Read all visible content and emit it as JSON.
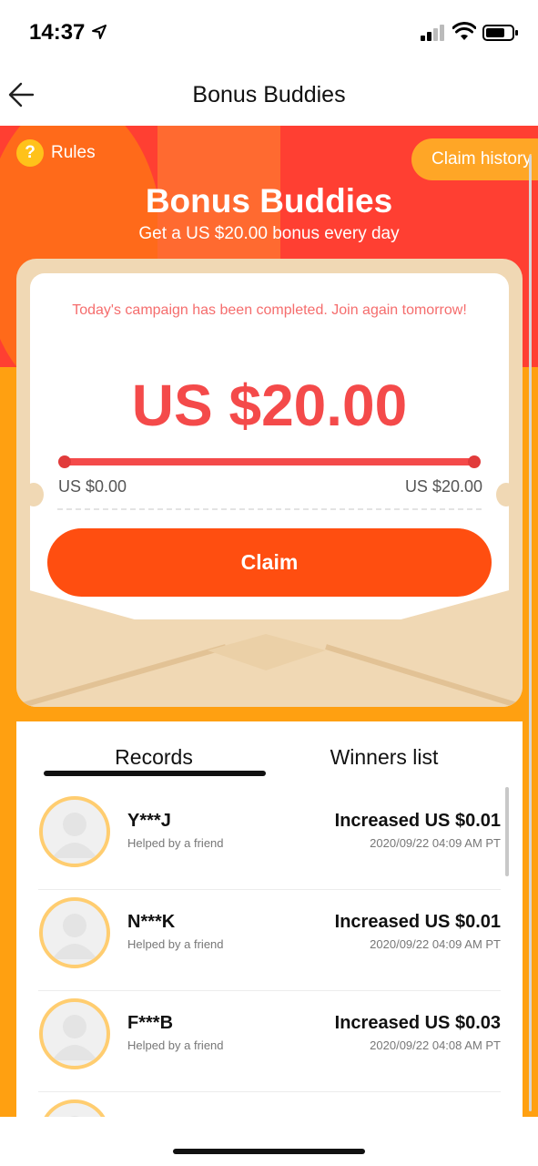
{
  "status_bar": {
    "time": "14:37"
  },
  "nav": {
    "title": "Bonus Buddies"
  },
  "hero": {
    "rules_label": "Rules",
    "claim_history_label": "Claim history",
    "title": "Bonus Buddies",
    "subtitle": "Get a US $20.00 bonus every day"
  },
  "envelope": {
    "campaign_note": "Today's campaign has been completed. Join again tomorrow!",
    "amount": "US $20.00",
    "progress": 1.0,
    "range_min": "US $0.00",
    "range_max": "US $20.00",
    "claim_label": "Claim"
  },
  "records": {
    "tabs": [
      {
        "label": "Records",
        "active": true
      },
      {
        "label": "Winners list",
        "active": false
      }
    ],
    "items": [
      {
        "name": "Y***J",
        "helped": "Helped by a friend",
        "amount": "Increased US $0.01",
        "date": "2020/09/22 04:09 AM PT"
      },
      {
        "name": "N***K",
        "helped": "Helped by a friend",
        "amount": "Increased US $0.01",
        "date": "2020/09/22 04:09 AM PT"
      },
      {
        "name": "F***B",
        "helped": "Helped by a friend",
        "amount": "Increased US $0.03",
        "date": "2020/09/22 04:08 AM PT"
      }
    ]
  },
  "colors": {
    "hero_red": "#ff3f32",
    "hero_orange": "#ffa011",
    "amount_red": "#f44a4a",
    "claim_button": "#ff4e10",
    "envelope": "#f0d8b4",
    "avatar_ring": "#ffcd70"
  }
}
